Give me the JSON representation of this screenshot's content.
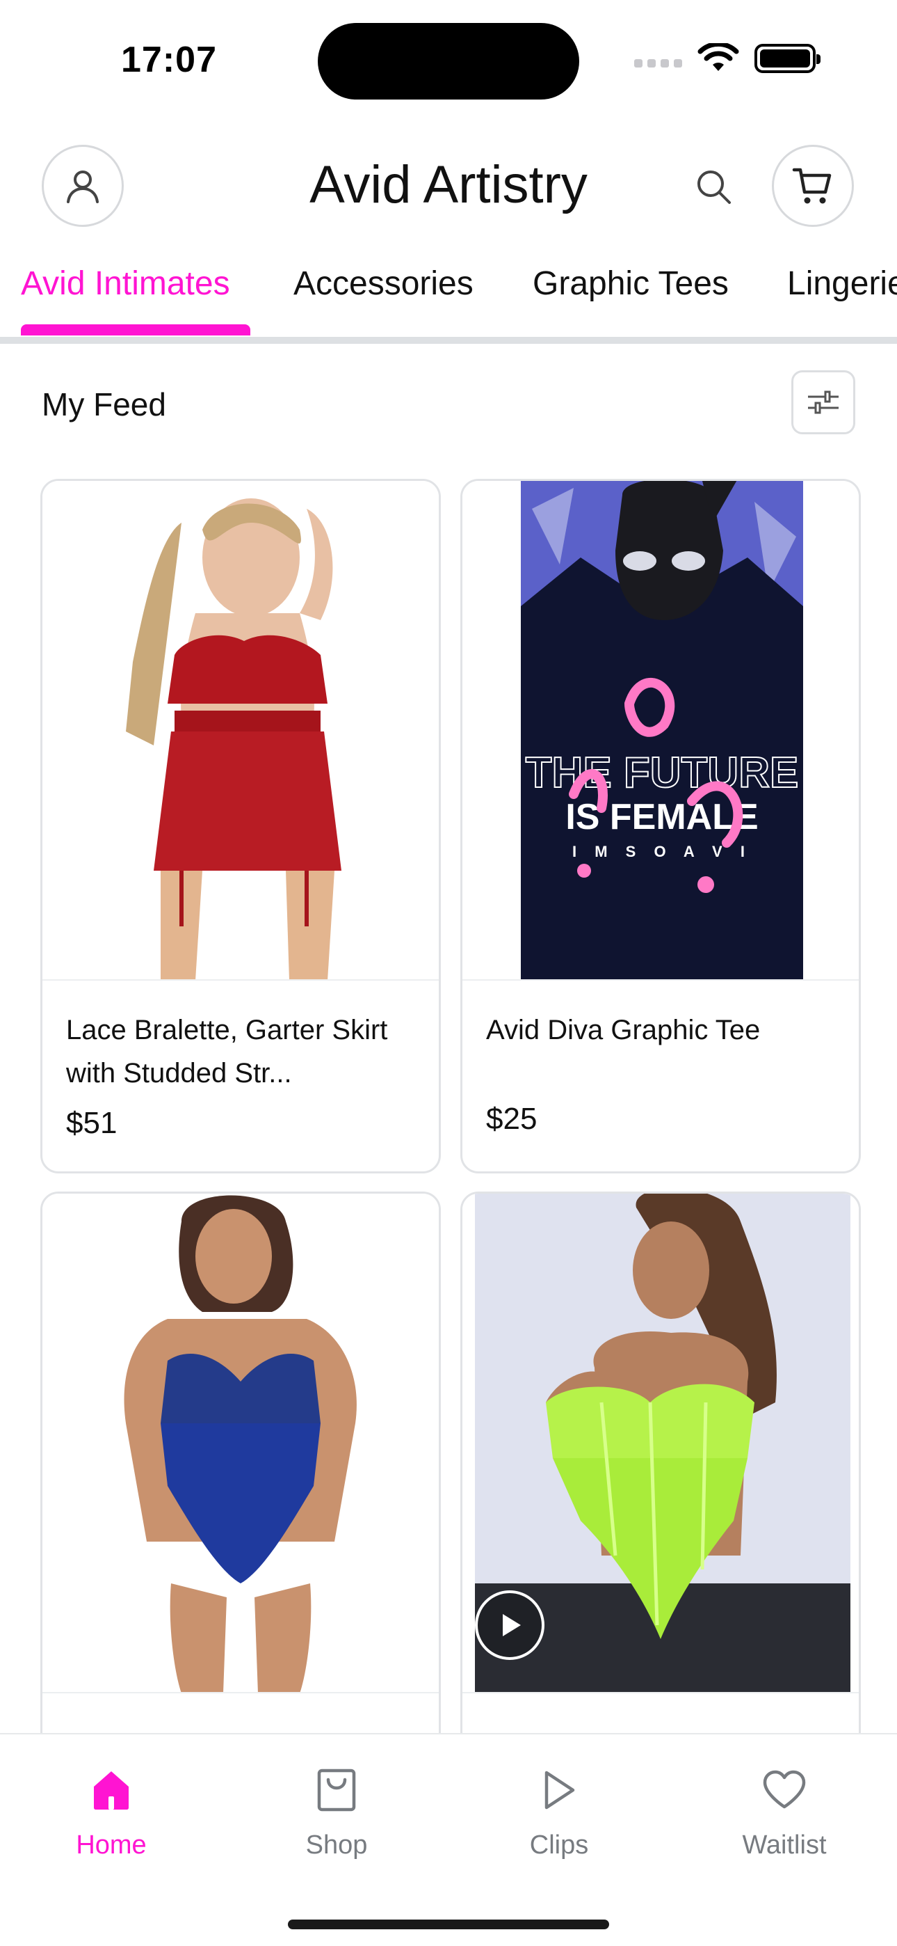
{
  "status_bar": {
    "time": "17:07"
  },
  "header": {
    "title": "Avid Artistry",
    "icons": {
      "profile": "person-icon",
      "search": "search-icon",
      "cart": "cart-icon"
    }
  },
  "tabs": [
    {
      "label": "Avid Intimates",
      "active": true
    },
    {
      "label": "Accessories",
      "active": false
    },
    {
      "label": "Graphic Tees",
      "active": false
    },
    {
      "label": "Lingerie",
      "active": false
    }
  ],
  "feed": {
    "title": "My Feed",
    "filter_icon": "sliders-icon",
    "products": [
      {
        "name": "Lace Bralette, Garter Skirt with Studded Str...",
        "price": "$51"
      },
      {
        "name": "Avid Diva Graphic Tee",
        "price": "$25",
        "shirt_text": [
          "THE FUTURE",
          "IS FEMALE",
          "I M S O A V I"
        ]
      },
      {
        "name": "",
        "price": ""
      },
      {
        "name": "",
        "price": "",
        "has_video": true
      }
    ]
  },
  "tabbar": [
    {
      "label": "Home",
      "icon": "home-icon",
      "active": true
    },
    {
      "label": "Shop",
      "icon": "shopping-bag-icon",
      "active": false
    },
    {
      "label": "Clips",
      "icon": "play-icon",
      "active": false
    },
    {
      "label": "Waitlist",
      "icon": "heart-icon",
      "active": false
    }
  ],
  "colors": {
    "accent": "#ff14d2",
    "divider": "#dde0e3",
    "inactive": "#777b80"
  }
}
